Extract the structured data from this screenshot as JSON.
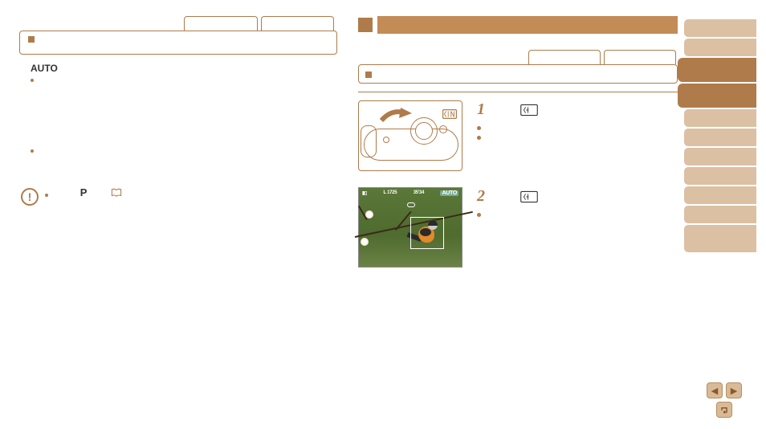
{
  "left": {
    "tabs": [
      "",
      ""
    ],
    "box_marker": "section-marker",
    "auto_label": "AUTO",
    "bullets": [
      {
        "text": ""
      },
      {
        "text": ""
      }
    ],
    "caution": {
      "icon": "!",
      "mode": "P",
      "ref_icon": "book"
    }
  },
  "right": {
    "banner_marker": "heading-marker",
    "tabs": [
      "",
      ""
    ],
    "box_marker": "section-marker",
    "steps": [
      {
        "num": "1",
        "tele_icon": "telephoto-icon",
        "bullets": [
          "",
          ""
        ]
      },
      {
        "num": "2",
        "tele_icon": "telephoto-icon",
        "bullets": [
          ""
        ]
      }
    ],
    "preview": {
      "overlay_left": "L 1725",
      "overlay_mid": "35'34",
      "overlay_auto": "AUTO"
    }
  },
  "sidebar": {
    "items": [
      {
        "active": false,
        "short": true
      },
      {
        "active": false,
        "short": true
      },
      {
        "active": true,
        "short": false
      },
      {
        "active": true,
        "short": false
      },
      {
        "active": false,
        "short": true
      },
      {
        "active": false,
        "short": true
      },
      {
        "active": false,
        "short": true
      },
      {
        "active": false,
        "short": true
      },
      {
        "active": false,
        "short": true
      },
      {
        "active": false,
        "short": true
      },
      {
        "active": false,
        "short": true
      }
    ]
  },
  "nav": {
    "prev": "◀",
    "next": "▶",
    "return": "return"
  }
}
